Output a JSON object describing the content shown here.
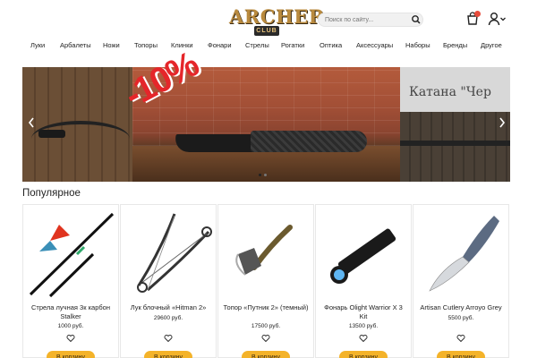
{
  "header": {
    "logo_main": "ARCHER",
    "logo_sub": "CLUB",
    "search_placeholder": "Поиск по сайту..."
  },
  "nav": [
    "Луки",
    "Арбалеты",
    "Ножи",
    "Топоры",
    "Клинки",
    "Фонари",
    "Стрелы",
    "Рогатки",
    "Оптика",
    "Аксессуары",
    "Наборы",
    "Бренды",
    "Другое"
  ],
  "slider": {
    "promo_text": "-10%",
    "right_slide_text": "Катана \"Чер"
  },
  "popular": {
    "title": "Популярное",
    "add_to_cart_label": "В корзину",
    "products": [
      {
        "name": "Стрела лучная 3к карбон Stalker",
        "price": "1000 руб."
      },
      {
        "name": "Лук блочный «Hitman 2»",
        "price": "29600 руб."
      },
      {
        "name": "Топор «Путник 2» (темный)",
        "price": "17500 руб."
      },
      {
        "name": "Фонарь Olight Warrior X 3 Kit",
        "price": "13500 руб."
      },
      {
        "name": "Artisan Cutlery Arroyo Grey",
        "price": "5500 руб."
      }
    ]
  },
  "colors": {
    "accent": "#f4b32a",
    "logo_gold": "#b98a3e",
    "promo_red": "#e5262a",
    "badge_red": "#e74c3c"
  }
}
